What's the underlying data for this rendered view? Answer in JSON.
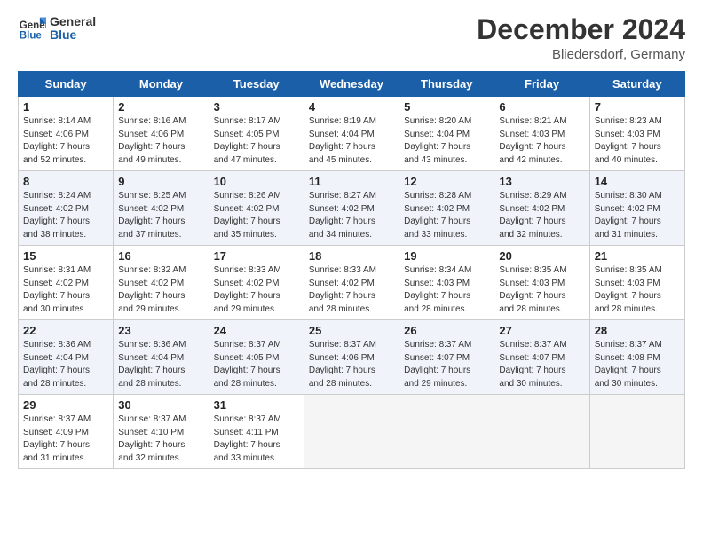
{
  "header": {
    "logo_line1": "General",
    "logo_line2": "Blue",
    "month": "December 2024",
    "location": "Bliedersdorf, Germany"
  },
  "weekdays": [
    "Sunday",
    "Monday",
    "Tuesday",
    "Wednesday",
    "Thursday",
    "Friday",
    "Saturday"
  ],
  "weeks": [
    [
      {
        "day": "1",
        "info": "Sunrise: 8:14 AM\nSunset: 4:06 PM\nDaylight: 7 hours\nand 52 minutes."
      },
      {
        "day": "2",
        "info": "Sunrise: 8:16 AM\nSunset: 4:06 PM\nDaylight: 7 hours\nand 49 minutes."
      },
      {
        "day": "3",
        "info": "Sunrise: 8:17 AM\nSunset: 4:05 PM\nDaylight: 7 hours\nand 47 minutes."
      },
      {
        "day": "4",
        "info": "Sunrise: 8:19 AM\nSunset: 4:04 PM\nDaylight: 7 hours\nand 45 minutes."
      },
      {
        "day": "5",
        "info": "Sunrise: 8:20 AM\nSunset: 4:04 PM\nDaylight: 7 hours\nand 43 minutes."
      },
      {
        "day": "6",
        "info": "Sunrise: 8:21 AM\nSunset: 4:03 PM\nDaylight: 7 hours\nand 42 minutes."
      },
      {
        "day": "7",
        "info": "Sunrise: 8:23 AM\nSunset: 4:03 PM\nDaylight: 7 hours\nand 40 minutes."
      }
    ],
    [
      {
        "day": "8",
        "info": "Sunrise: 8:24 AM\nSunset: 4:02 PM\nDaylight: 7 hours\nand 38 minutes."
      },
      {
        "day": "9",
        "info": "Sunrise: 8:25 AM\nSunset: 4:02 PM\nDaylight: 7 hours\nand 37 minutes."
      },
      {
        "day": "10",
        "info": "Sunrise: 8:26 AM\nSunset: 4:02 PM\nDaylight: 7 hours\nand 35 minutes."
      },
      {
        "day": "11",
        "info": "Sunrise: 8:27 AM\nSunset: 4:02 PM\nDaylight: 7 hours\nand 34 minutes."
      },
      {
        "day": "12",
        "info": "Sunrise: 8:28 AM\nSunset: 4:02 PM\nDaylight: 7 hours\nand 33 minutes."
      },
      {
        "day": "13",
        "info": "Sunrise: 8:29 AM\nSunset: 4:02 PM\nDaylight: 7 hours\nand 32 minutes."
      },
      {
        "day": "14",
        "info": "Sunrise: 8:30 AM\nSunset: 4:02 PM\nDaylight: 7 hours\nand 31 minutes."
      }
    ],
    [
      {
        "day": "15",
        "info": "Sunrise: 8:31 AM\nSunset: 4:02 PM\nDaylight: 7 hours\nand 30 minutes."
      },
      {
        "day": "16",
        "info": "Sunrise: 8:32 AM\nSunset: 4:02 PM\nDaylight: 7 hours\nand 29 minutes."
      },
      {
        "day": "17",
        "info": "Sunrise: 8:33 AM\nSunset: 4:02 PM\nDaylight: 7 hours\nand 29 minutes."
      },
      {
        "day": "18",
        "info": "Sunrise: 8:33 AM\nSunset: 4:02 PM\nDaylight: 7 hours\nand 28 minutes."
      },
      {
        "day": "19",
        "info": "Sunrise: 8:34 AM\nSunset: 4:03 PM\nDaylight: 7 hours\nand 28 minutes."
      },
      {
        "day": "20",
        "info": "Sunrise: 8:35 AM\nSunset: 4:03 PM\nDaylight: 7 hours\nand 28 minutes."
      },
      {
        "day": "21",
        "info": "Sunrise: 8:35 AM\nSunset: 4:03 PM\nDaylight: 7 hours\nand 28 minutes."
      }
    ],
    [
      {
        "day": "22",
        "info": "Sunrise: 8:36 AM\nSunset: 4:04 PM\nDaylight: 7 hours\nand 28 minutes."
      },
      {
        "day": "23",
        "info": "Sunrise: 8:36 AM\nSunset: 4:04 PM\nDaylight: 7 hours\nand 28 minutes."
      },
      {
        "day": "24",
        "info": "Sunrise: 8:37 AM\nSunset: 4:05 PM\nDaylight: 7 hours\nand 28 minutes."
      },
      {
        "day": "25",
        "info": "Sunrise: 8:37 AM\nSunset: 4:06 PM\nDaylight: 7 hours\nand 28 minutes."
      },
      {
        "day": "26",
        "info": "Sunrise: 8:37 AM\nSunset: 4:07 PM\nDaylight: 7 hours\nand 29 minutes."
      },
      {
        "day": "27",
        "info": "Sunrise: 8:37 AM\nSunset: 4:07 PM\nDaylight: 7 hours\nand 30 minutes."
      },
      {
        "day": "28",
        "info": "Sunrise: 8:37 AM\nSunset: 4:08 PM\nDaylight: 7 hours\nand 30 minutes."
      }
    ],
    [
      {
        "day": "29",
        "info": "Sunrise: 8:37 AM\nSunset: 4:09 PM\nDaylight: 7 hours\nand 31 minutes."
      },
      {
        "day": "30",
        "info": "Sunrise: 8:37 AM\nSunset: 4:10 PM\nDaylight: 7 hours\nand 32 minutes."
      },
      {
        "day": "31",
        "info": "Sunrise: 8:37 AM\nSunset: 4:11 PM\nDaylight: 7 hours\nand 33 minutes."
      },
      {
        "day": "",
        "info": ""
      },
      {
        "day": "",
        "info": ""
      },
      {
        "day": "",
        "info": ""
      },
      {
        "day": "",
        "info": ""
      }
    ]
  ]
}
